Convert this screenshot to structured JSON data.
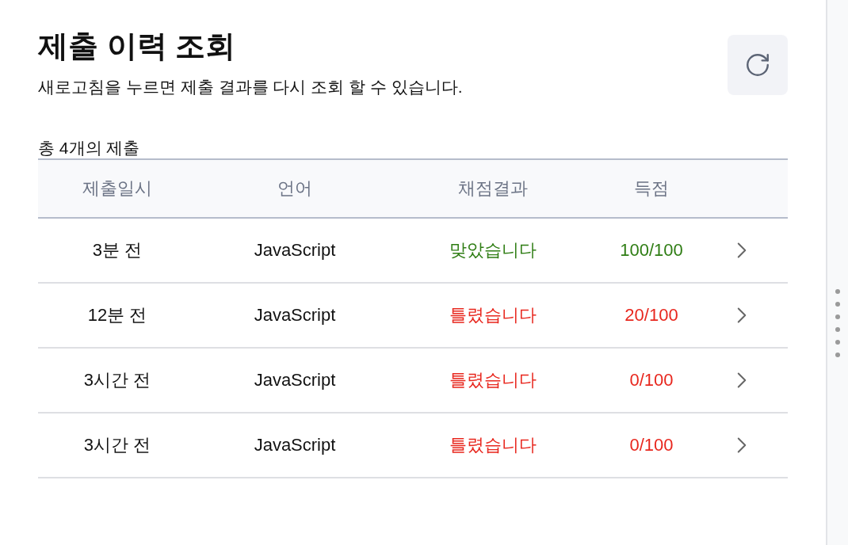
{
  "header": {
    "title": "제출 이력 조회",
    "subtitle": "새로고침을 누르면 제출 결과를 다시 조회 할 수 있습니다."
  },
  "count_label": "총 4개의 제출",
  "table": {
    "columns": [
      "제출일시",
      "언어",
      "채점결과",
      "득점"
    ],
    "rows": [
      {
        "time": "3분 전",
        "language": "JavaScript",
        "result": "맞았습니다",
        "score": "100/100",
        "passed": true
      },
      {
        "time": "12분 전",
        "language": "JavaScript",
        "result": "틀렸습니다",
        "score": "20/100",
        "passed": false
      },
      {
        "time": "3시간 전",
        "language": "JavaScript",
        "result": "틀렸습니다",
        "score": "0/100",
        "passed": false
      },
      {
        "time": "3시간 전",
        "language": "JavaScript",
        "result": "틀렸습니다",
        "score": "0/100",
        "passed": false
      }
    ]
  }
}
